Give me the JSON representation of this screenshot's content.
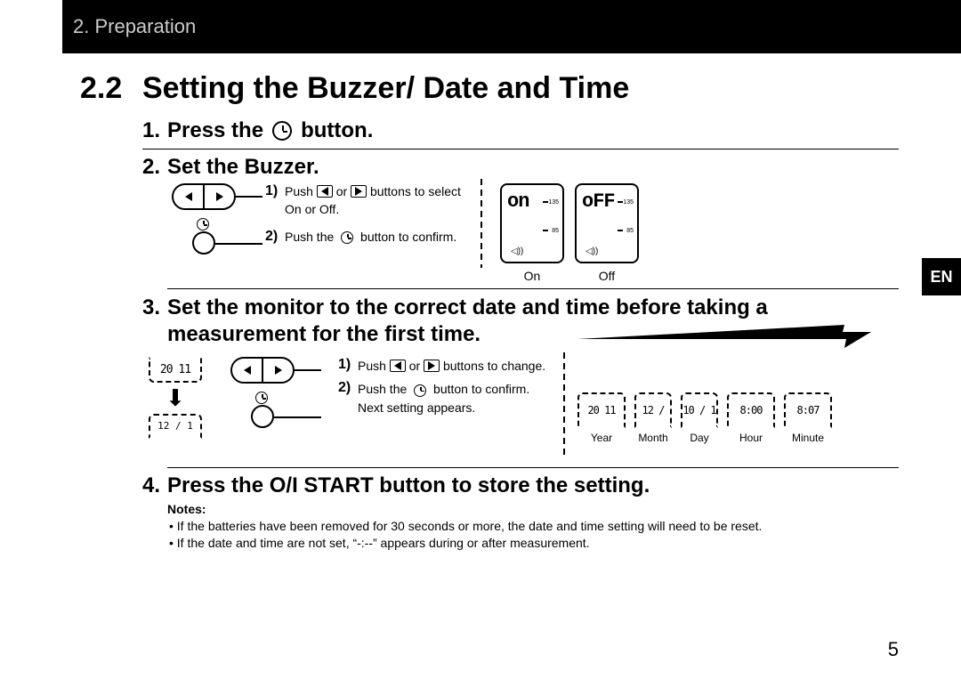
{
  "header": {
    "breadcrumb": "2. Preparation"
  },
  "lang_tab": "EN",
  "section": {
    "number": "2.2",
    "title": "Setting the Buzzer/ Date and Time"
  },
  "steps": {
    "s1": {
      "num": "1.",
      "pre": "Press the",
      "post": "button."
    },
    "s2": {
      "num": "2.",
      "text": "Set the Buzzer.",
      "sub1": {
        "n": "1)",
        "pre": "Push",
        "mid": "or",
        "post": "buttons to select On or Off."
      },
      "sub2": {
        "n": "2)",
        "pre": "Push the",
        "post": "button to confirm."
      },
      "disp_on": {
        "main": "on",
        "t135": "135",
        "t85": "85",
        "label": "On"
      },
      "disp_off": {
        "main": "oFF",
        "t135": "135",
        "t85": "85",
        "label": "Off"
      }
    },
    "s3": {
      "num": "3.",
      "text": "Set the monitor to the correct date and time before taking a measurement for the first time.",
      "year_top": "20 11",
      "year_bot": "12 / 1",
      "sub1": {
        "n": "1)",
        "pre": "Push",
        "mid": "or",
        "post": "buttons to change."
      },
      "sub2": {
        "n": "2)",
        "pre": "Push the",
        "post": "button to confirm. Next setting appears."
      },
      "timeline": {
        "year": {
          "val": "20 11",
          "label": "Year"
        },
        "month": {
          "val": "12 /",
          "label": "Month"
        },
        "day": {
          "val": "10 / 1",
          "label": "Day"
        },
        "hour": {
          "val": "8:00",
          "label": "Hour"
        },
        "minute": {
          "val": "8:07",
          "label": "Minute"
        }
      }
    },
    "s4": {
      "num": "4.",
      "text": "Press the O/I START button to store the setting."
    },
    "notes": {
      "title": "Notes:",
      "n1": "If the batteries have been removed for 30 seconds or more, the date and time setting will need to be reset.",
      "n2": "If the date and time are not set, “-:--” appears during or after measurement."
    }
  },
  "page_number": "5"
}
